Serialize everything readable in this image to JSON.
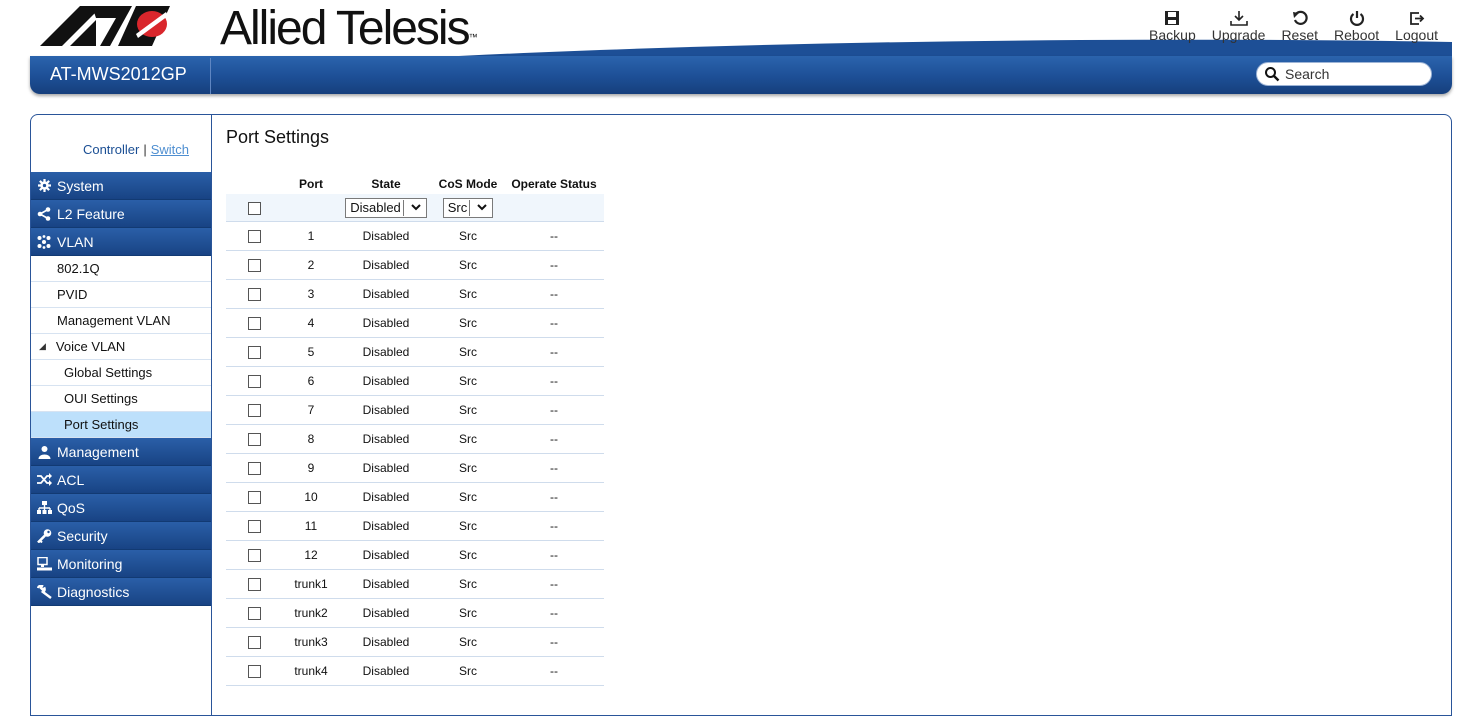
{
  "brand": {
    "name": "Allied Telesis",
    "trademark": "™"
  },
  "toolbar": {
    "backup": {
      "label": "Backup",
      "icon": "floppy-icon"
    },
    "upgrade": {
      "label": "Upgrade",
      "icon": "download-icon"
    },
    "reset": {
      "label": "Reset",
      "icon": "reset-icon"
    },
    "reboot": {
      "label": "Reboot",
      "icon": "power-icon"
    },
    "logout": {
      "label": "Logout",
      "icon": "logout-icon"
    }
  },
  "header": {
    "model": "AT-MWS2012GP",
    "search_placeholder": "Search"
  },
  "switcher": {
    "controller": "Controller",
    "separator": "|",
    "switch": "Switch"
  },
  "sidebar": {
    "system": "System",
    "l2_feature": "L2 Feature",
    "vlan": "VLAN",
    "vlan_items": {
      "dot1q": "802.1Q",
      "pvid": "PVID",
      "mgmt_vlan": "Management VLAN",
      "voice_vlan": "Voice VLAN",
      "voice_global": "Global Settings",
      "voice_oui": "OUI Settings",
      "voice_port": "Port Settings"
    },
    "management": "Management",
    "acl": "ACL",
    "qos": "QoS",
    "security": "Security",
    "monitoring": "Monitoring",
    "diagnostics": "Diagnostics"
  },
  "page": {
    "title": "Port Settings",
    "columns": {
      "port": "Port",
      "state": "State",
      "cos_mode": "CoS Mode",
      "operate_status": "Operate Status"
    },
    "filter": {
      "state": "Disabled",
      "cos_mode": "Src"
    },
    "rows": [
      {
        "port": "1",
        "state": "Disabled",
        "cos": "Src",
        "status": "--"
      },
      {
        "port": "2",
        "state": "Disabled",
        "cos": "Src",
        "status": "--"
      },
      {
        "port": "3",
        "state": "Disabled",
        "cos": "Src",
        "status": "--"
      },
      {
        "port": "4",
        "state": "Disabled",
        "cos": "Src",
        "status": "--"
      },
      {
        "port": "5",
        "state": "Disabled",
        "cos": "Src",
        "status": "--"
      },
      {
        "port": "6",
        "state": "Disabled",
        "cos": "Src",
        "status": "--"
      },
      {
        "port": "7",
        "state": "Disabled",
        "cos": "Src",
        "status": "--"
      },
      {
        "port": "8",
        "state": "Disabled",
        "cos": "Src",
        "status": "--"
      },
      {
        "port": "9",
        "state": "Disabled",
        "cos": "Src",
        "status": "--"
      },
      {
        "port": "10",
        "state": "Disabled",
        "cos": "Src",
        "status": "--"
      },
      {
        "port": "11",
        "state": "Disabled",
        "cos": "Src",
        "status": "--"
      },
      {
        "port": "12",
        "state": "Disabled",
        "cos": "Src",
        "status": "--"
      },
      {
        "port": "trunk1",
        "state": "Disabled",
        "cos": "Src",
        "status": "--"
      },
      {
        "port": "trunk2",
        "state": "Disabled",
        "cos": "Src",
        "status": "--"
      },
      {
        "port": "trunk3",
        "state": "Disabled",
        "cos": "Src",
        "status": "--"
      },
      {
        "port": "trunk4",
        "state": "Disabled",
        "cos": "Src",
        "status": "--"
      }
    ]
  },
  "colors": {
    "nav_blue": "#1d4f96",
    "selected": "#bde0fb",
    "accent_red": "#d9262c"
  }
}
